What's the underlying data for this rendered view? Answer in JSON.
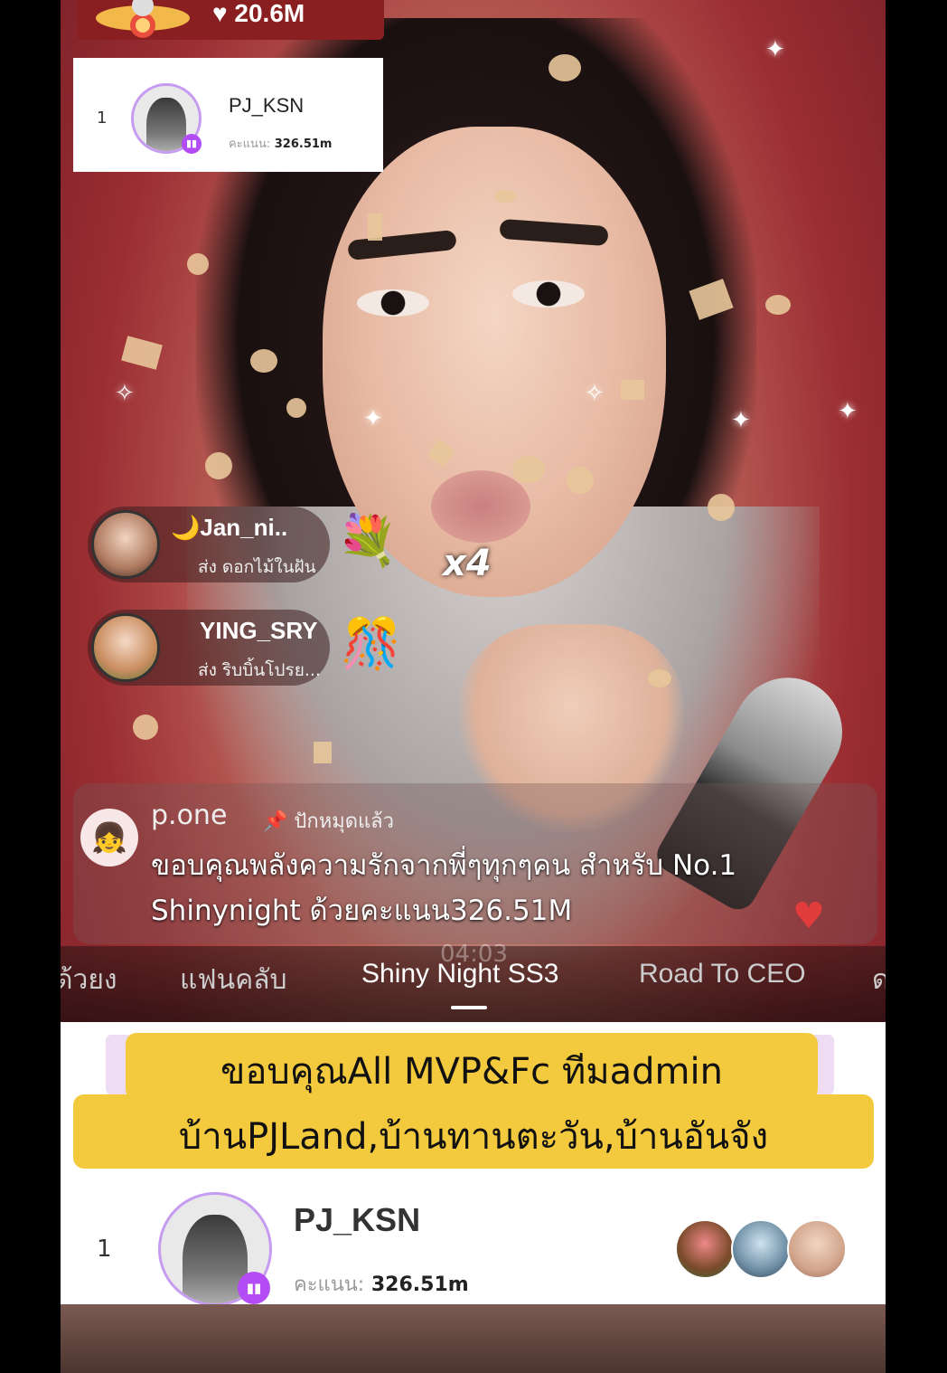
{
  "stream": {
    "like_count": "20.6M",
    "combo_label": "x4"
  },
  "top_rank": {
    "position": "1",
    "username": "PJ_KSN",
    "score_label": "คะแนน:",
    "score_value": "326.51m"
  },
  "gifts": [
    {
      "username": "🌙Jan_ni..",
      "message": "ส่ง ดอกไม้ในฝัน",
      "icon": "flower-bouquet-icon"
    },
    {
      "username": "YING_SRY",
      "message": "ส่ง ริบบิ้นโปรย...",
      "icon": "ribbon-confetti-icon"
    }
  ],
  "pinned_comment": {
    "username": "p.one",
    "pin_label": "ปักหมุดแล้ว",
    "message": "ขอบคุณพลังความรักจากพี่ๆทุกๆคน สำหรับ No.1 Shinynight ด้วยคะแนน326.51M"
  },
  "tabs": {
    "timer": "04:03",
    "items": [
      "ด้วยง",
      "แฟนคลับ",
      "Shiny Night SS3",
      "Road To CEO",
      "ด"
    ],
    "active_index": 2
  },
  "banner": {
    "line1": "ขอบคุณAll MVP&Fc ทีมadmin",
    "line2": "บ้านPJLand,บ้านทานตะวัน,บ้านอันจัง"
  },
  "bottom_rank": {
    "position": "1",
    "username": "PJ_KSN",
    "score_label": "คะแนน:",
    "score_value": "326.51m",
    "supporter_count": 3
  },
  "colors": {
    "banner_yellow": "#f3c93e",
    "badge_purple": "#b44cf5",
    "avatar_ring": "#c69bf0",
    "top_bar": "#8a1f22"
  }
}
